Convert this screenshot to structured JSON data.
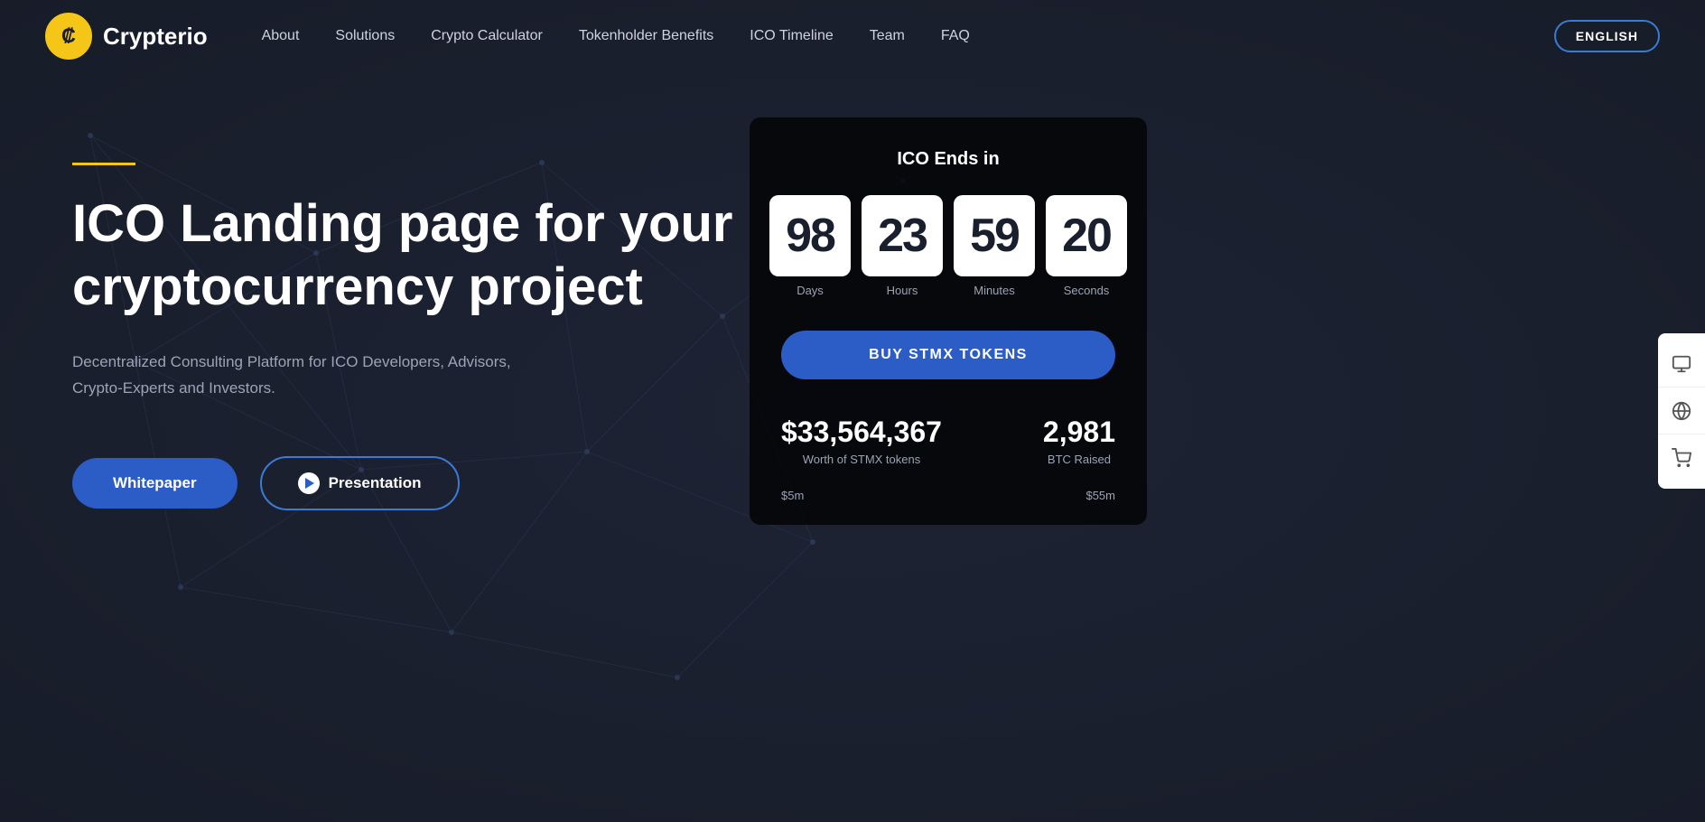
{
  "nav": {
    "logo_text": "Crypterio",
    "links": [
      {
        "label": "About",
        "id": "about"
      },
      {
        "label": "Solutions",
        "id": "solutions"
      },
      {
        "label": "Crypto Calculator",
        "id": "crypto-calculator"
      },
      {
        "label": "Tokenholder Benefits",
        "id": "tokenholder-benefits"
      },
      {
        "label": "ICO Timeline",
        "id": "ico-timeline"
      },
      {
        "label": "Team",
        "id": "team"
      },
      {
        "label": "FAQ",
        "id": "faq"
      }
    ],
    "lang_button": "ENGLISH"
  },
  "hero": {
    "title": "ICO Landing page for your cryptocurrency project",
    "subtitle": "Decentralized Consulting Platform for ICO Developers, Advisors, Crypto-Experts and Investors.",
    "btn_whitepaper": "Whitepaper",
    "btn_presentation": "Presentation"
  },
  "ico_widget": {
    "title": "ICO Ends in",
    "countdown": {
      "days": "98",
      "hours": "23",
      "minutes": "59",
      "seconds": "20",
      "days_label": "Days",
      "hours_label": "Hours",
      "minutes_label": "Minutes",
      "seconds_label": "Seconds"
    },
    "buy_button": "BUY STMX TOKENS",
    "stat_value_1": "$33,564,367",
    "stat_label_1": "Worth of STMX tokens",
    "stat_value_2": "2,981",
    "stat_label_2": "BTC Raised",
    "progress_min": "$5m",
    "progress_max": "$55m"
  },
  "side_icons": {
    "monitor": "🖥",
    "globe": "🌐",
    "cart": "🛒"
  },
  "colors": {
    "accent_yellow": "#f5c518",
    "accent_blue": "#2c5cc5",
    "bg_dark": "#1a1f2e",
    "text_muted": "#9ba3b5"
  }
}
